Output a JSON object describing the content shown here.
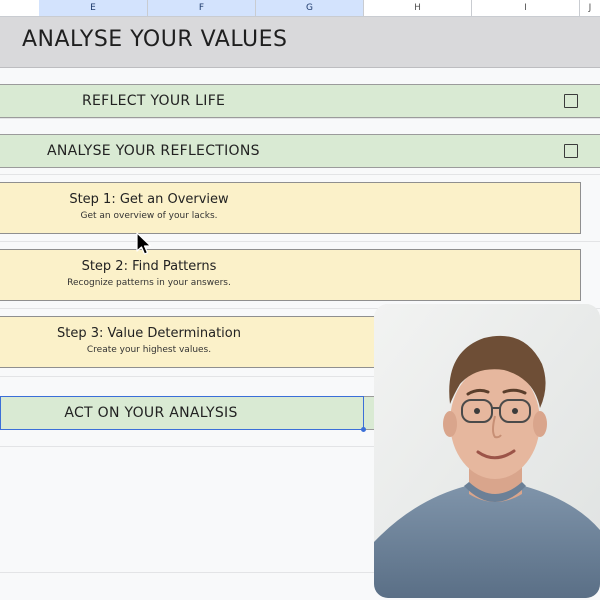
{
  "sheet": {
    "columns": [
      "E",
      "F",
      "G",
      "H",
      "I",
      "J"
    ],
    "selected_columns": [
      "E",
      "F",
      "G"
    ]
  },
  "title": "ANALYSE YOUR VALUES",
  "sections": {
    "reflect": "REFLECT YOUR LIFE",
    "analyse": "ANALYSE YOUR REFLECTIONS",
    "act": "ACT ON YOUR ANALYSIS"
  },
  "steps": [
    {
      "title": "Step 1: Get an Overview",
      "desc": "Get an overview of your lacks."
    },
    {
      "title": "Step 2: Find Patterns",
      "desc": "Recognize patterns in your answers."
    },
    {
      "title": "Step 3: Value Determination",
      "desc": "Create your highest values."
    }
  ],
  "colors": {
    "green": "#d9ead3",
    "yellow": "#fbf1c9",
    "selection": "#3b6fd8",
    "title_bg": "#d9d9db"
  },
  "icons": [
    "checkbox-icon",
    "mouse-cursor-icon"
  ],
  "overlay": "presenter-webcam-video"
}
